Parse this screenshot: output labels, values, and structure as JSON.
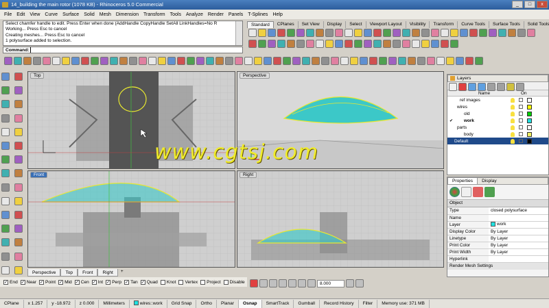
{
  "window": {
    "title": "14_building the main rotor (1078 KB) - Rhinoceros 5.0 Commercial",
    "controls": [
      "_",
      "□",
      "x"
    ]
  },
  "menu": [
    "File",
    "Edit",
    "View",
    "Curve",
    "Surface",
    "Solid",
    "Mesh",
    "Dimension",
    "Transform",
    "Tools",
    "Analyze",
    "Render",
    "Panels",
    "T-Splines",
    "Help"
  ],
  "command": {
    "history": [
      "Select chamfer handle to edit. Press Enter when done (AddHandle  CopyHandle  SetAll  LinkHandles=No  R",
      "Working... Press Esc to cancel",
      "Creating meshes... Press Esc to cancel",
      "1 polysurface added to selection."
    ],
    "prompt": "Command:"
  },
  "toolbar_tabs": [
    "Standard",
    "CPlanes",
    "Set View",
    "Display",
    "Select",
    "Viewport Layout",
    "Visibility",
    "Transform",
    "Curve Tools",
    "Surface Tools",
    "Solid Tools"
  ],
  "active_toolbar_tab": "Standard",
  "viewports": {
    "top": "Top",
    "perspective": "Perspective",
    "front": "Front",
    "right": "Right"
  },
  "viewport_tabs": [
    "Perspective",
    "Top",
    "Front",
    "Right"
  ],
  "layers": {
    "title": "Layers",
    "columns": [
      "Name",
      "On"
    ],
    "items": [
      {
        "name": "ref images",
        "color": "#ffffff"
      },
      {
        "name": "wires",
        "color": "#ffff00"
      },
      {
        "name": "old",
        "color": "#00d000"
      },
      {
        "name": "work",
        "color": "#20e0e0",
        "current": true
      },
      {
        "name": "parts",
        "color": "#ffffff"
      },
      {
        "name": "body",
        "color": "#f0f060"
      },
      {
        "name": "Default",
        "color": "#000000",
        "selected": true
      }
    ]
  },
  "properties": {
    "tabs": [
      "Properties",
      "Display"
    ],
    "section": "Object",
    "rows": [
      {
        "label": "Type",
        "value": "closed polysurface"
      },
      {
        "label": "Name",
        "value": ""
      },
      {
        "label": "Layer",
        "value": "work"
      },
      {
        "label": "Display Color",
        "value": "By Layer"
      },
      {
        "label": "Linetype",
        "value": "By Layer"
      },
      {
        "label": "Print Color",
        "value": "By Layer"
      },
      {
        "label": "Print Width",
        "value": "By Layer"
      },
      {
        "label": "Hyperlink",
        "value": ""
      }
    ],
    "footer": "Render Mesh Settings"
  },
  "osnap": [
    {
      "label": "End",
      "on": true
    },
    {
      "label": "Near",
      "on": true
    },
    {
      "label": "Point",
      "on": true
    },
    {
      "label": "Mid",
      "on": true
    },
    {
      "label": "Cen",
      "on": true
    },
    {
      "label": "Int",
      "on": true
    },
    {
      "label": "Perp",
      "on": true
    },
    {
      "label": "Tan",
      "on": true
    },
    {
      "label": "Quad",
      "on": true
    },
    {
      "label": "Knot",
      "on": false
    },
    {
      "label": "Vertex",
      "on": false
    },
    {
      "label": "Project",
      "on": false
    },
    {
      "label": "Disable",
      "on": false
    }
  ],
  "bottom_value": "8.000",
  "status": {
    "cplane": "CPlane",
    "x": "x 1.257",
    "y": "y -18.972",
    "z": "z 0.000",
    "units": "Millimeters",
    "layer": "wires::work",
    "toggles": [
      "Grid Snap",
      "Ortho",
      "Planar",
      "Osnap",
      "SmartTrack",
      "Gumball",
      "Record History",
      "Filter"
    ],
    "active_toggle": "Osnap",
    "memory": "Memory use: 371 MB"
  },
  "watermark": "www.cgtsj.com",
  "colors": {
    "accent": "#3a6fb5",
    "surface": "#3cc8c8",
    "highlight": "#e8e830"
  }
}
